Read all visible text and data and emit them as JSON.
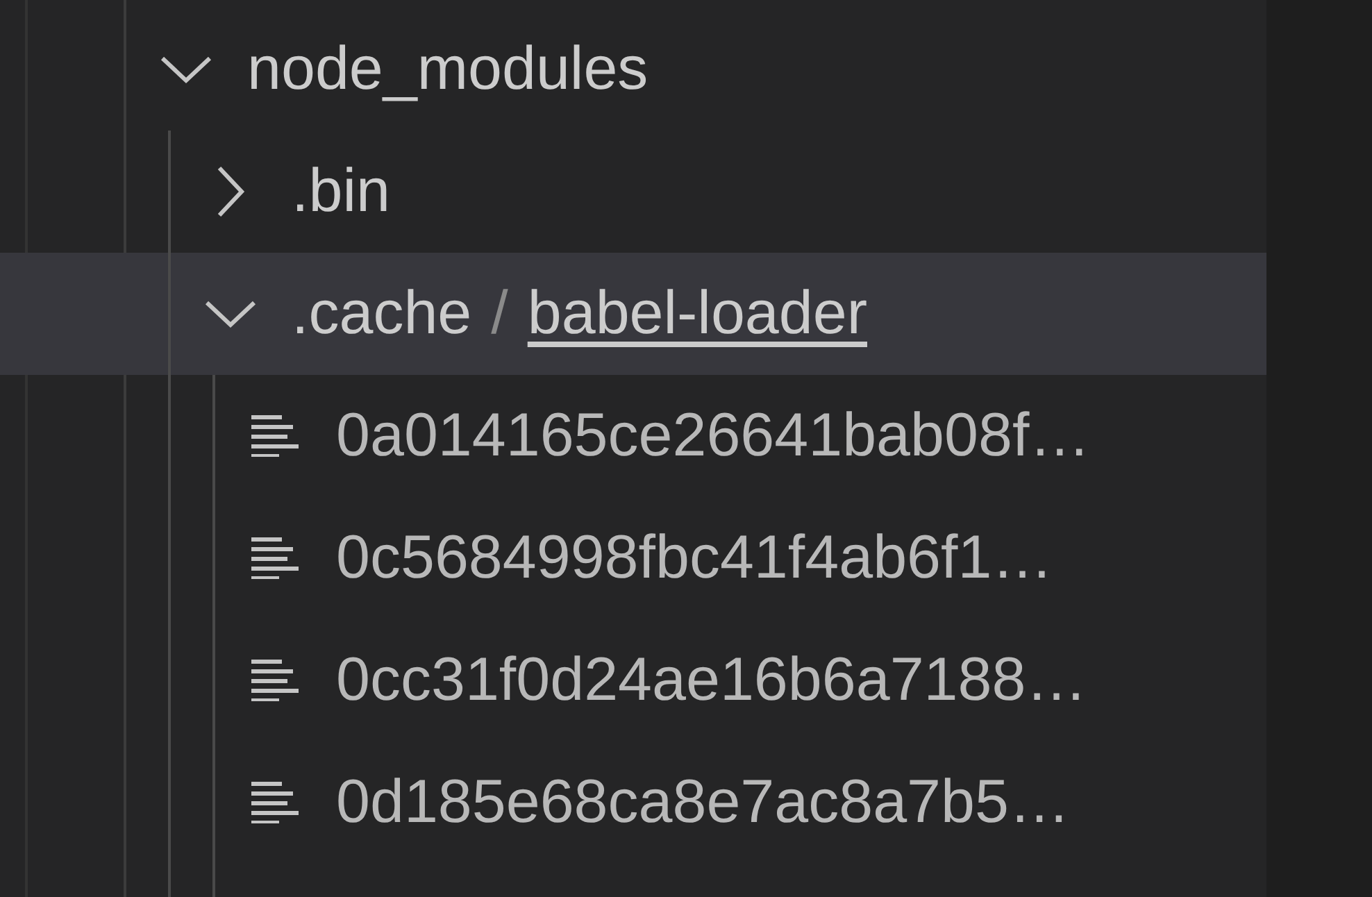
{
  "explorer": {
    "tree": [
      {
        "kind": "folder",
        "name": "node_modules",
        "expanded": true,
        "selected": false,
        "children": [
          {
            "kind": "folder",
            "name": ".bin",
            "expanded": false,
            "selected": false
          },
          {
            "kind": "folder",
            "name": ".cache",
            "separator": "/",
            "subfolder": "babel-loader",
            "expanded": true,
            "selected": true,
            "children": [
              {
                "kind": "file",
                "name": "0a014165ce26641bab08f…",
                "selected": false
              },
              {
                "kind": "file",
                "name": "0c5684998fbc41f4ab6f1…",
                "selected": false
              },
              {
                "kind": "file",
                "name": "0cc31f0d24ae16b6a7188…",
                "selected": false
              },
              {
                "kind": "file",
                "name": "0d185e68ca8e7ac8a7b5…",
                "selected": false
              }
            ]
          }
        ]
      }
    ]
  }
}
